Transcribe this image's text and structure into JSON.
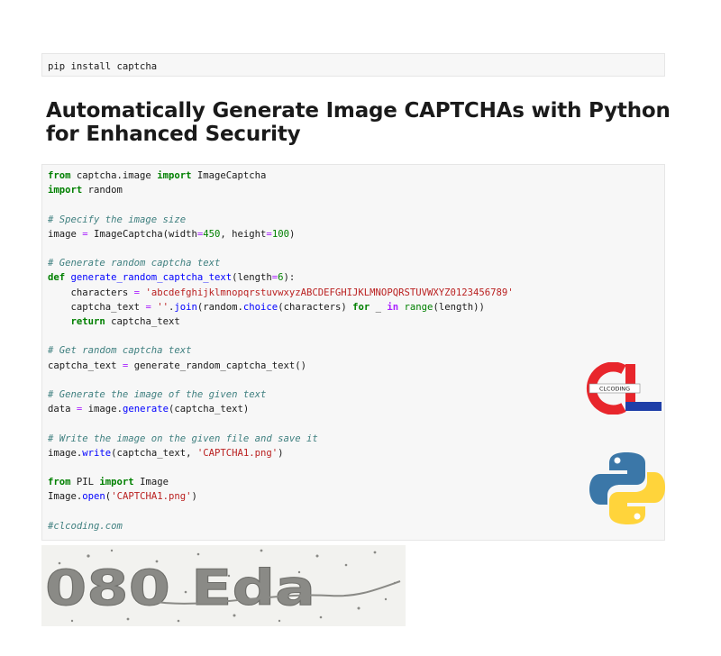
{
  "pip_cell": {
    "code": "pip install captcha"
  },
  "heading": "Automatically Generate Image CAPTCHAs with Python for Enhanced Security",
  "code": {
    "l1": {
      "kw1": "from",
      "mod": " captcha.image ",
      "kw2": "import",
      "rest": " ImageCaptcha"
    },
    "l2": {
      "kw": "import",
      "rest": " random"
    },
    "c1": "# Specify the image size",
    "l3": {
      "a": "image ",
      "eq": "=",
      "b": " ImageCaptcha(width",
      "eq2": "=",
      "n1": "450",
      "c": ", height",
      "eq3": "=",
      "n2": "100",
      "d": ")"
    },
    "c2": "# Generate random captcha text",
    "l4": {
      "kw": "def",
      "name": " generate_random_captcha_text",
      "a": "(length",
      "eq": "=",
      "n": "6",
      "b": "):"
    },
    "l5": {
      "indent": "    characters ",
      "eq": "=",
      "str": " 'abcdefghijklmnopqrstuvwxyzABCDEFGHIJKLMNOPQRSTUVWXYZ0123456789'"
    },
    "l6": {
      "indent": "    captcha_text ",
      "eq": "=",
      "str": " ''",
      "dot": ".",
      "fn": "join",
      "a": "(random",
      "dot2": ".",
      "fn2": "choice",
      "b": "(characters) ",
      "kw": "for",
      "c": " _ ",
      "kw2": "in",
      "bi": " range",
      "d": "(length))"
    },
    "l7": {
      "indent": "    ",
      "kw": "return",
      "rest": " captcha_text"
    },
    "c3": "# Get random captcha text",
    "l8": {
      "a": "captcha_text ",
      "eq": "=",
      "b": " generate_random_captcha_text()"
    },
    "c4": "# Generate the image of the given text",
    "l9": {
      "a": "data ",
      "eq": "=",
      "b": " image",
      "dot": ".",
      "fn": "generate",
      "c": "(captcha_text)"
    },
    "c5": "# Write the image on the given file and save it",
    "l10": {
      "a": "image",
      "dot": ".",
      "fn": "write",
      "b": "(captcha_text, ",
      "str": "'CAPTCHA1.png'",
      "c": ")"
    },
    "l11": {
      "kw1": "from",
      "mod": " PIL ",
      "kw2": "import",
      "rest": " Image"
    },
    "l12": {
      "a": "Image",
      "dot": ".",
      "fn": "open",
      "b": "(",
      "str": "'CAPTCHA1.png'",
      "c": ")"
    },
    "c6": "#clcoding.com"
  },
  "logo_cl": {
    "text": "CLCODING",
    "colors": {
      "red": "#e8262c",
      "blue": "#1f3fa8"
    }
  },
  "logo_python": {
    "colors": {
      "blue": "#3b77a8",
      "yellow": "#ffd43b"
    }
  },
  "captcha_image": {
    "text": "080 Eda",
    "color": "#8a8a86"
  }
}
